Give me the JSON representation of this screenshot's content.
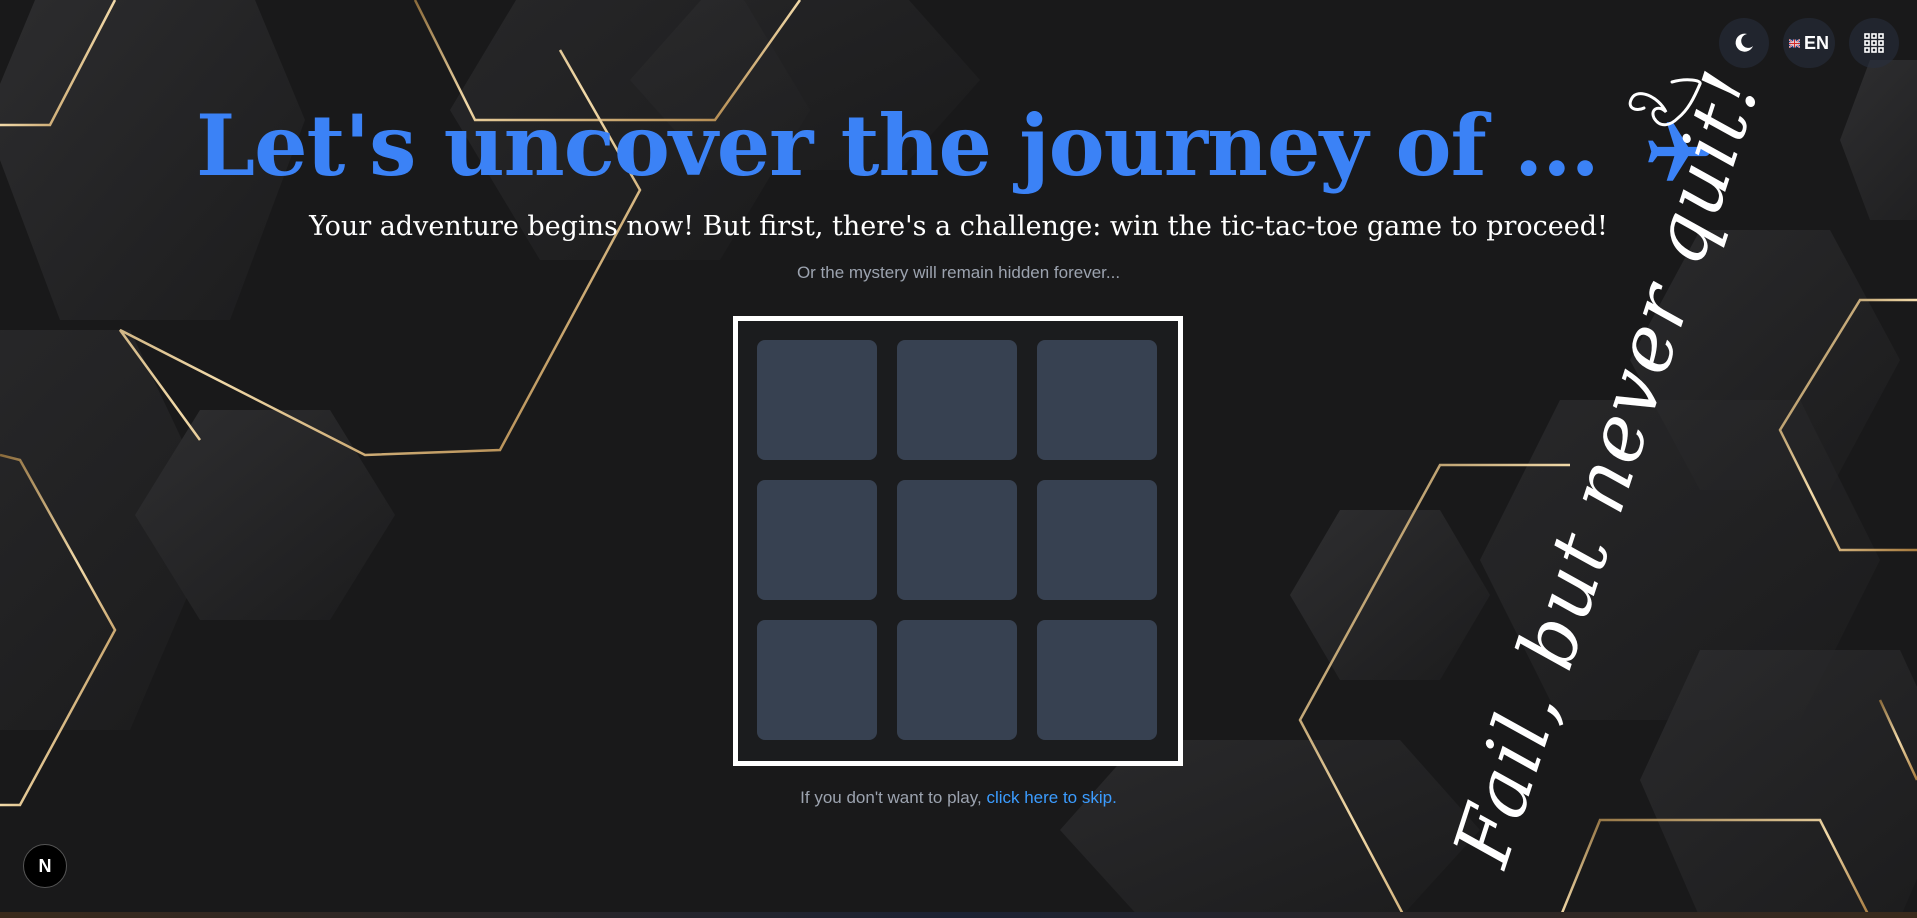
{
  "header": {
    "title": "Let's uncover the journey of ...",
    "plane_icon": "airplane-icon",
    "subtitle": "Your adventure begins now! But first, there's a challenge: win the tic-tac-toe game to proceed!",
    "hint": "Or the mystery will remain hidden forever..."
  },
  "controls": {
    "theme_icon": "moon-icon",
    "language_label": "EN",
    "language_flag": "uk-flag-icon",
    "apps_icon": "grid-icon"
  },
  "board": {
    "cells": [
      "",
      "",
      "",
      "",
      "",
      "",
      "",
      "",
      ""
    ]
  },
  "footer": {
    "skip_prefix": "If you don't want to play, ",
    "skip_link": "click here to skip."
  },
  "decor": {
    "motto": "Fail, but never quit!",
    "heart_icon": "heart-icon"
  },
  "badge": {
    "label": "N"
  },
  "colors": {
    "accent": "#3b82f6",
    "link": "#3b9cff",
    "cell": "#374151",
    "background": "#19191a",
    "gold": "#c9a46a"
  }
}
